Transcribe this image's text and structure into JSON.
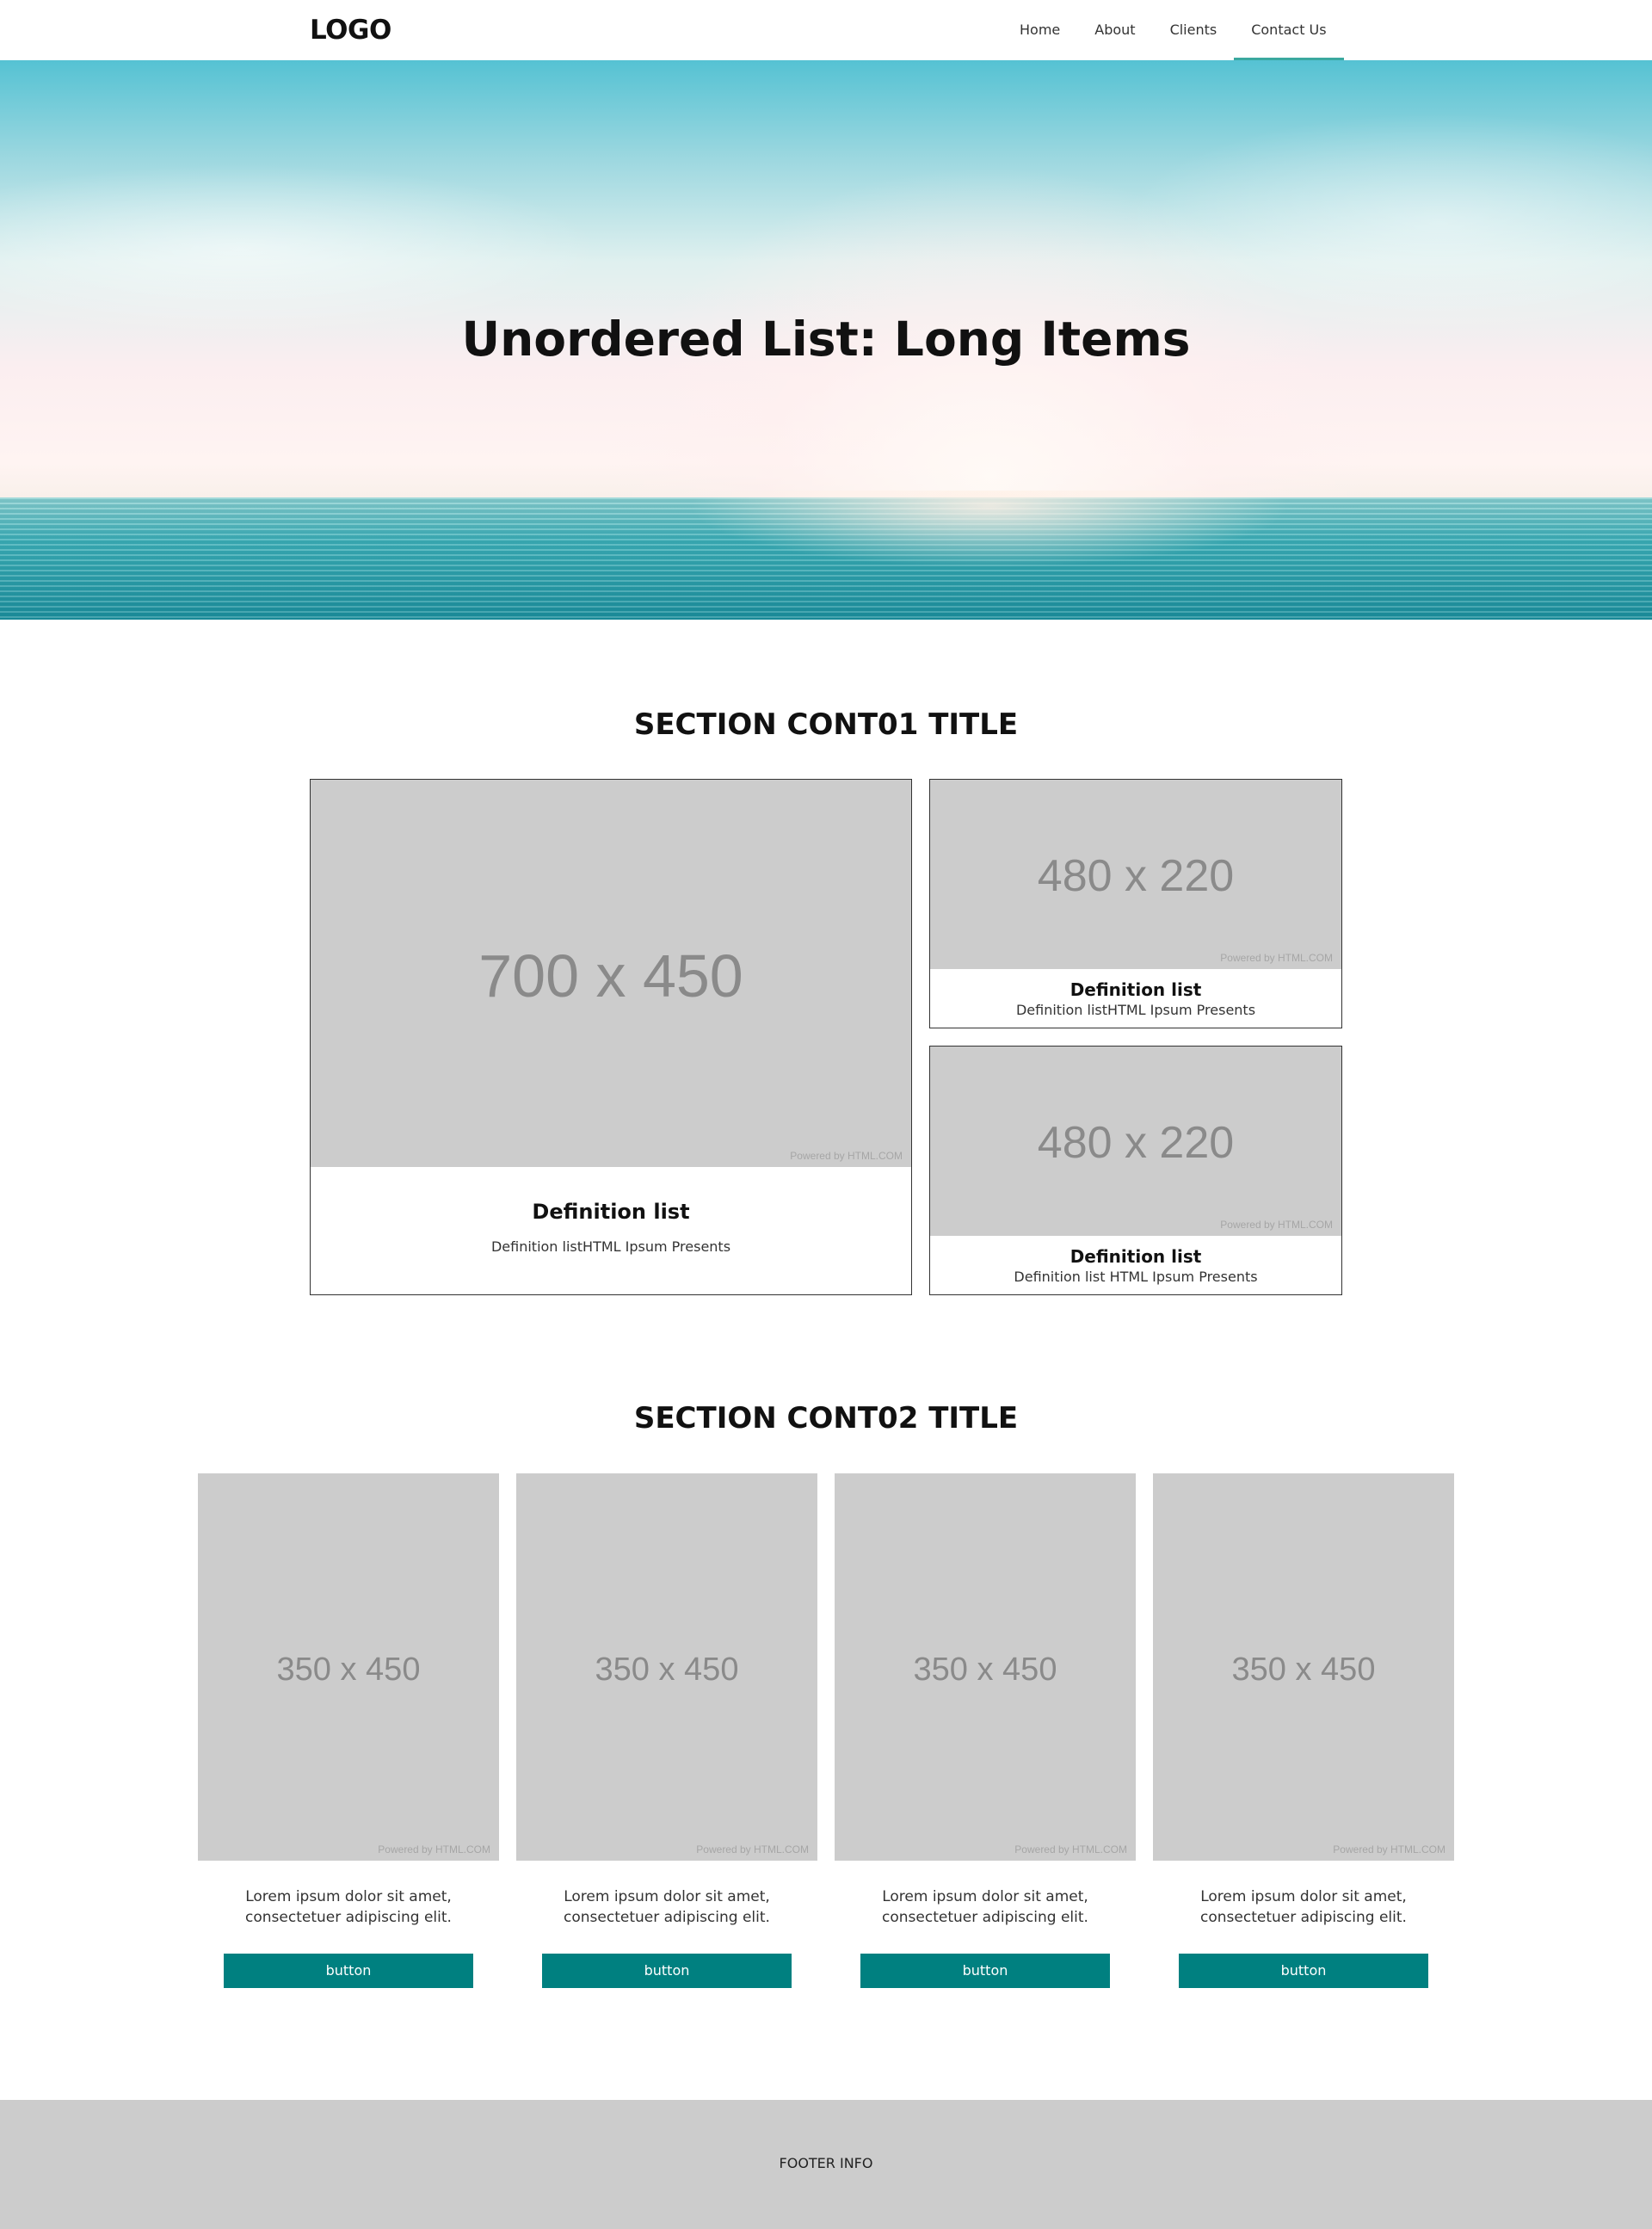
{
  "header": {
    "logo": "LOGO",
    "nav": [
      "Home",
      "About",
      "Clients",
      "Contact Us"
    ]
  },
  "hero": {
    "title": "Unordered List: Long Items"
  },
  "cont01": {
    "title": "SECTION CONT01 TITLE",
    "cards": [
      {
        "image_label": "700 x 450",
        "powered": "Powered by HTML.COM",
        "title": "Definition list",
        "desc": "Definition listHTML Ipsum Presents"
      },
      {
        "image_label": "480 x 220",
        "powered": "Powered by HTML.COM",
        "title": "Definition list",
        "desc": "Definition listHTML Ipsum Presents"
      },
      {
        "image_label": "480 x 220",
        "powered": "Powered by HTML.COM",
        "title": "Definition list",
        "desc": "Definition list HTML Ipsum Presents"
      }
    ]
  },
  "cont02": {
    "title": "SECTION CONT02 TITLE",
    "items": [
      {
        "image_label": "350 x 450",
        "powered": "Powered by HTML.COM",
        "line1": "Lorem ipsum dolor sit amet,",
        "line2": "consectetuer adipiscing elit.",
        "button": "button"
      },
      {
        "image_label": "350 x 450",
        "powered": "Powered by HTML.COM",
        "line1": "Lorem ipsum dolor sit amet,",
        "line2": "consectetuer adipiscing elit.",
        "button": "button"
      },
      {
        "image_label": "350 x 450",
        "powered": "Powered by HTML.COM",
        "line1": "Lorem ipsum dolor sit amet,",
        "line2": "consectetuer adipiscing elit.",
        "button": "button"
      },
      {
        "image_label": "350 x 450",
        "powered": "Powered by HTML.COM",
        "line1": "Lorem ipsum dolor sit amet,",
        "line2": "consectetuer adipiscing elit.",
        "button": "button"
      }
    ]
  },
  "footer": {
    "info": "FOOTER INFO"
  },
  "colors": {
    "accent": "#3aa89f",
    "button": "#008080",
    "placeholder": "#cccccc",
    "footer_bg": "#cccccc"
  }
}
